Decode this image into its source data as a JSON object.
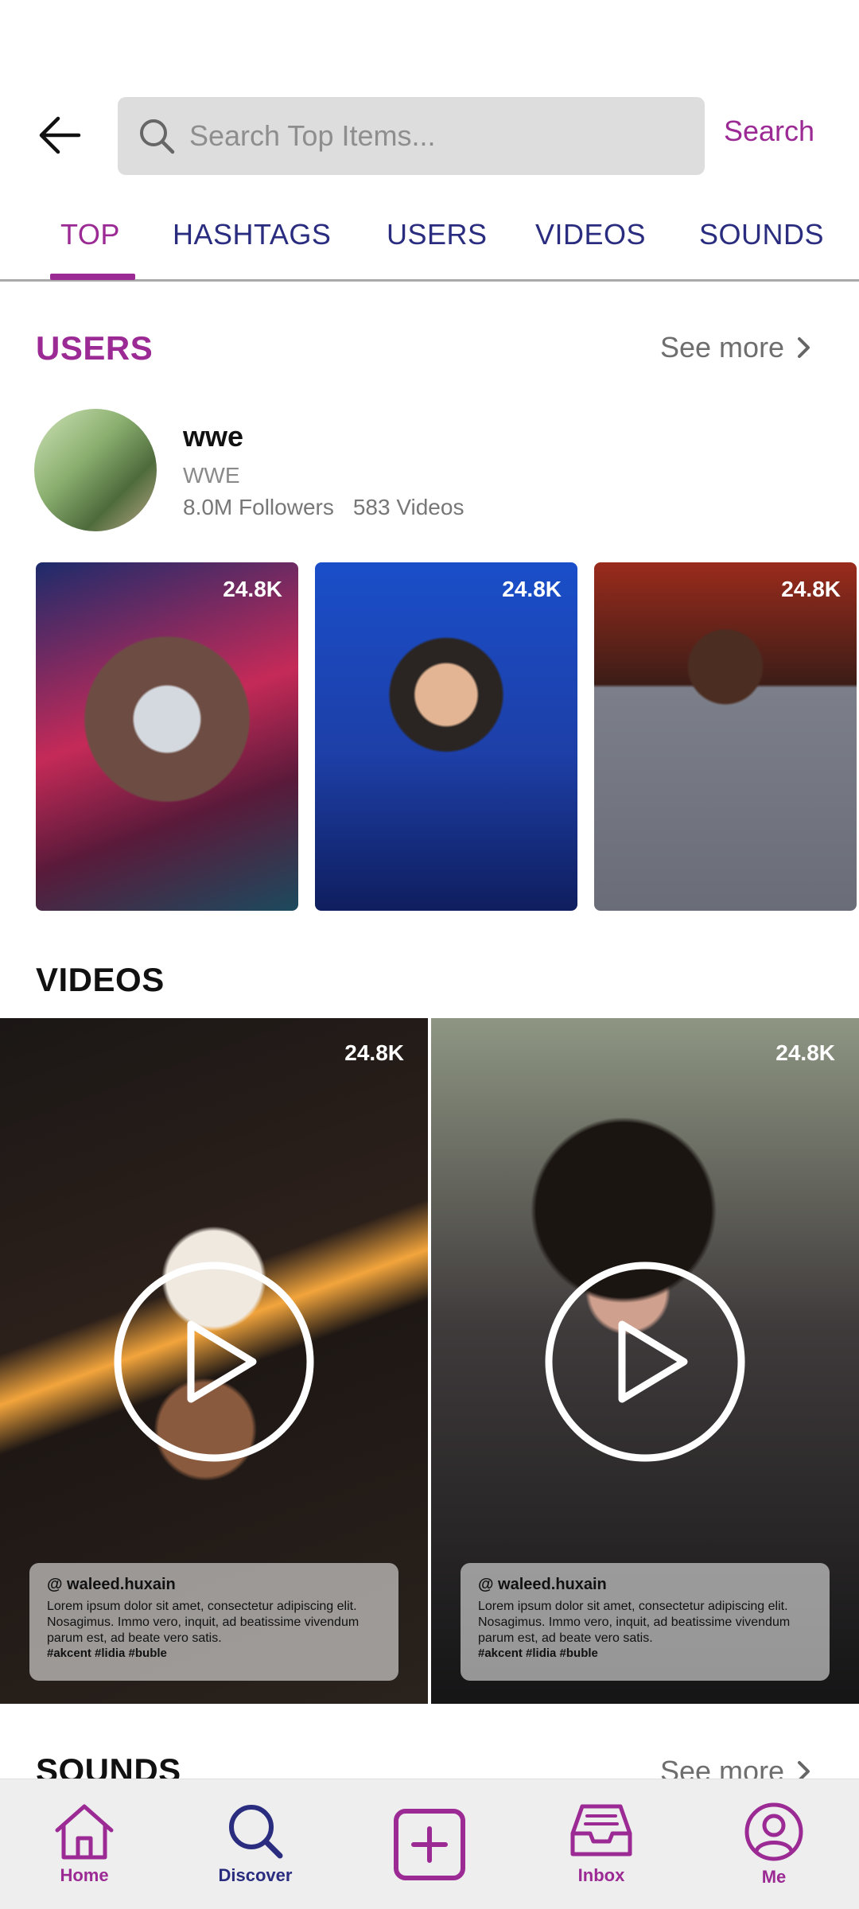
{
  "header": {
    "search_placeholder": "Search Top Items...",
    "search_button_label": "Search"
  },
  "tabs": [
    {
      "label": "TOP",
      "active": true
    },
    {
      "label": "HASHTAGS",
      "active": false
    },
    {
      "label": "USERS",
      "active": false
    },
    {
      "label": "VIDEOS",
      "active": false
    },
    {
      "label": "SOUNDS",
      "active": false
    }
  ],
  "users_section": {
    "title": "USERS",
    "see_more_label": "See more",
    "user": {
      "name": "wwe",
      "handle": "WWE",
      "followers": "8.0M Followers",
      "videos": "583 Videos"
    },
    "thumbnails": [
      {
        "count": "24.8K"
      },
      {
        "count": "24.8K"
      },
      {
        "count": "24.8K"
      }
    ]
  },
  "videos_section": {
    "title": "VIDEOS",
    "items": [
      {
        "count": "24.8K",
        "handle": "@ waleed.huxain",
        "text": "Lorem ipsum dolor sit amet, consectetur adipiscing elit. Nosagimus. Immo vero, inquit, ad beatissime vivendum parum est, ad beate vero satis.",
        "tags": "#akcent #lidia #buble"
      },
      {
        "count": "24.8K",
        "handle": "@ waleed.huxain",
        "text": "Lorem ipsum dolor sit amet, consectetur adipiscing elit. Nosagimus. Immo vero, inquit, ad beatissime vivendum parum est, ad beate vero satis.",
        "tags": "#akcent #lidia #buble"
      }
    ]
  },
  "sounds_section": {
    "title": "SOUNDS",
    "see_more_label": "See more"
  },
  "bottom_nav": [
    {
      "label": "Home",
      "icon": "home-icon"
    },
    {
      "label": "Discover",
      "icon": "search-icon"
    },
    {
      "label": "",
      "icon": "add-icon"
    },
    {
      "label": "Inbox",
      "icon": "inbox-icon"
    },
    {
      "label": "Me",
      "icon": "profile-icon"
    }
  ],
  "colors": {
    "accent_purple": "#9b2a94",
    "navy": "#2a2d7f",
    "search_bg": "#dddddd"
  }
}
